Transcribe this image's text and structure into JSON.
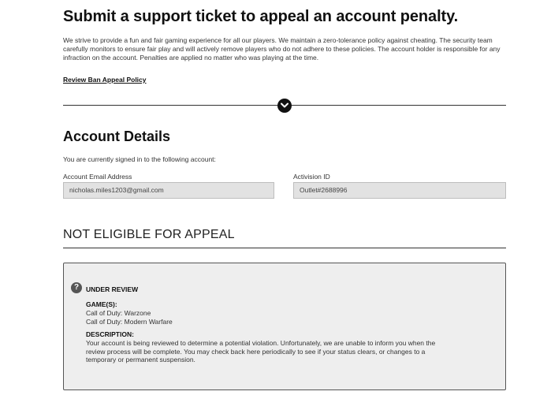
{
  "header": {
    "title": "Submit a support ticket to appeal an account penalty.",
    "intro": "We strive to provide a fun and fair gaming experience for all our players. We maintain a zero-tolerance policy against cheating. The security team carefully monitors to ensure fair play and will actively remove players who do not adhere to these policies. The account holder is responsible for any infraction on the account. Penalties are applied no matter who was playing at the time.",
    "policy_link": "Review Ban Appeal Policy"
  },
  "divider": {
    "icon": "chevron-down-icon"
  },
  "account": {
    "title": "Account Details",
    "signed_in_text": "You are currently signed in to the following account:",
    "email_label": "Account Email Address",
    "email_value": "nicholas.miles1203@gmail.com",
    "activision_label": "Activision ID",
    "activision_value": "Outlet#2688996"
  },
  "eligibility": {
    "title": "NOT ELIGIBLE FOR APPEAL",
    "status": {
      "icon": "question-icon",
      "icon_glyph": "?",
      "heading": "UNDER REVIEW",
      "games_label": "GAME(S):",
      "games": [
        "Call of Duty: Warzone",
        "Call of Duty: Modern Warfare"
      ],
      "description_label": "DESCRIPTION:",
      "description": "Your account is being reviewed to determine a potential violation. Unfortunately, we are unable to inform you when the review process will be complete. You may check back here periodically to see if your status clears, or changes to a temporary or permanent suspension."
    }
  },
  "colors": {
    "text": "#222222",
    "field_bg": "#e2e2e2",
    "box_bg": "#eeeeee",
    "accent": "#111111"
  }
}
